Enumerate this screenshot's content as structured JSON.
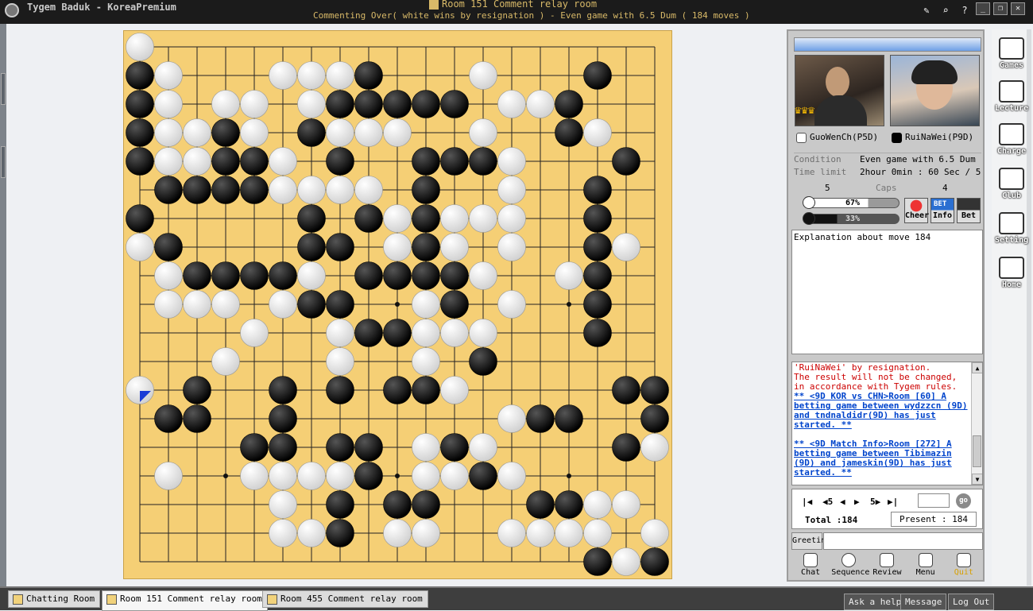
{
  "titlebar": {
    "app_title": "Tygem Baduk - KoreaPremium",
    "room_title": "Room 151 Comment relay room",
    "status": "Commenting Over( white wins by resignation ) - Even game with 6.5 Dum  ( 184 moves )"
  },
  "players": {
    "white": {
      "name": "GuoWenCh(P5D)",
      "caps": "5",
      "progress_label": "67%",
      "progress": 0.67
    },
    "black": {
      "name": "RuiNaWei(P9D)",
      "caps": "4",
      "progress_label": "33%",
      "progress": 0.33
    }
  },
  "game_info": {
    "condition_label": "Condition",
    "condition_value": "Even game with 6.5 Dum",
    "time_label": "Time limit",
    "time_value": "2hour 0min : 60 Sec / 5",
    "caps_label": "Caps"
  },
  "buttons": {
    "cheer": "Cheer",
    "info": "Info",
    "bet": "Bet",
    "bet_badge": "BET"
  },
  "explanation": "Explanation about move 184",
  "chat": {
    "lines": [
      {
        "text": "'RuiNaWei' by resignation.",
        "style": "red"
      },
      {
        "text": "The result will not be changed, in accordance with Tygem rules.",
        "style": "red"
      },
      {
        "text": "** <9D KOR vs CHN>Room [60] A betting game between wydzzcn (9D) and tndnaldidr(9D) has just started. **",
        "style": "link"
      },
      {
        "text": "** <9D Match Info>Room [272] A betting game between Tibimazin (9D) and jameskin(9D) has just started. **",
        "style": "link"
      }
    ]
  },
  "nav": {
    "first": "|◀",
    "back5": "◀5",
    "prev": "◀",
    "next": "▶",
    "fwd5": "5▶",
    "last": "▶|",
    "go": "go",
    "total": "Total :184",
    "present": "Present : 184"
  },
  "greeting_label": "Greeting",
  "bottom_buttons": [
    "Chat",
    "Sequence",
    "Review",
    "Menu",
    "Quit"
  ],
  "side_menu": [
    "Games",
    "Lecture",
    "Charge",
    "Club",
    "Setting",
    "Home"
  ],
  "taskbar": {
    "tabs": [
      "Chatting Room",
      "Room 151 Comment relay room",
      "Room 455 Comment relay room"
    ],
    "right_buttons": [
      "Ask a help",
      "Message",
      "Log Out"
    ]
  },
  "board": {
    "size": 19,
    "rows": [
      "W..................",
      "BW...WWWB...W...B..",
      "BW.WW.WBBBBB.WWB...",
      "BWWBW.BWWW..W..BW..",
      "BWWBBW.B..BBBW...B.",
      ".BBBBWWWW.B..W..B..",
      "B.....B.BWBWWW..B..",
      "WB....BB.WBW.W..BW.",
      ".WBBBBW.BBBBW..WB..",
      ".WWW.WBB..WB.W..B..",
      "....W..WBBWWW...B..",
      "...W...W..W.B......",
      "W.B..B.B.BBW.....BB",
      ".BB..B.......WBB..BW",
      "....BB.BB.WBW....BW",
      ".W..WWWWB.WWBW.....",
      ".....W.B.BB...BBWW.",
      ".....WWB.WW..WWWW.W",
      "................BWB"
    ],
    "last_move": "A6"
  }
}
